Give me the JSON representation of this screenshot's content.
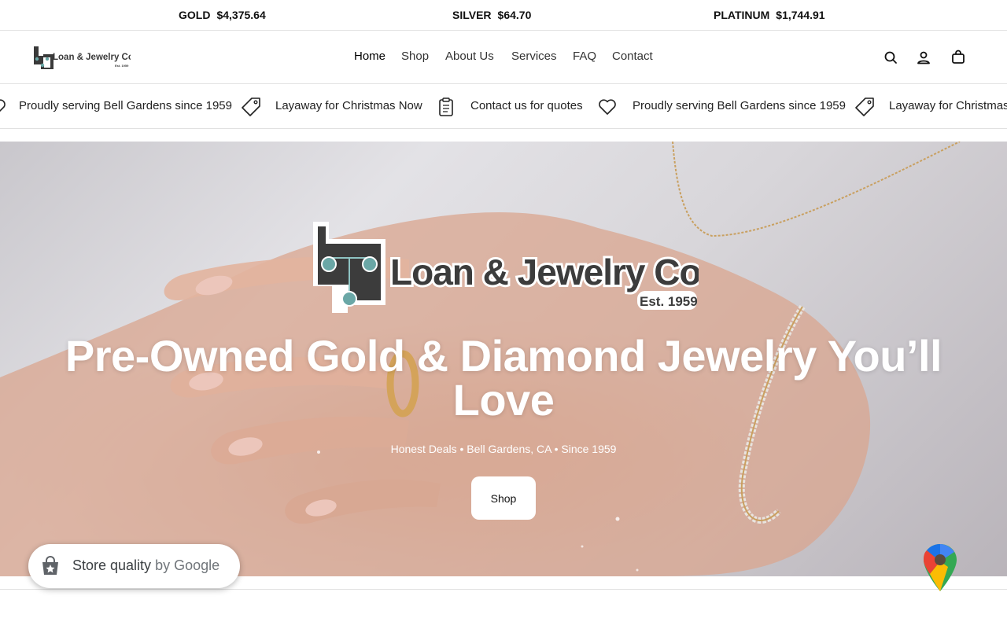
{
  "metals": [
    {
      "name": "GOLD",
      "price": "$4,375.64"
    },
    {
      "name": "SILVER",
      "price": "$64.70"
    },
    {
      "name": "PLATINUM",
      "price": "$1,744.91"
    }
  ],
  "header": {
    "logo_text": "Loan & Jewelry Co.",
    "logo_est": "Est. 1959",
    "nav": [
      "Home",
      "Shop",
      "About Us",
      "Services",
      "FAQ",
      "Contact"
    ],
    "icons": [
      "search-icon",
      "account-icon",
      "cart-icon"
    ]
  },
  "announcements": [
    {
      "icon": "heart-icon",
      "text": "Proudly serving Bell Gardens since 1959"
    },
    {
      "icon": "tag-icon",
      "text": "Layaway for Christmas Now"
    },
    {
      "icon": "clipboard-icon",
      "text": "Contact us for quotes"
    },
    {
      "icon": "heart-icon",
      "text": "Proudly serving Bell Gardens since 1959"
    },
    {
      "icon": "tag-icon",
      "text": "Layaway for Christmas"
    }
  ],
  "hero": {
    "logo_text": "Loan & Jewelry Co.",
    "logo_est": "Est. 1959",
    "title": "Pre-Owned Gold & Diamond Jewelry You’ll Love",
    "subtitle": "Honest Deals • Bell Gardens, CA • Since 1959",
    "button": "Shop"
  },
  "badge": {
    "title": "Store quality",
    "by": " by Google"
  }
}
